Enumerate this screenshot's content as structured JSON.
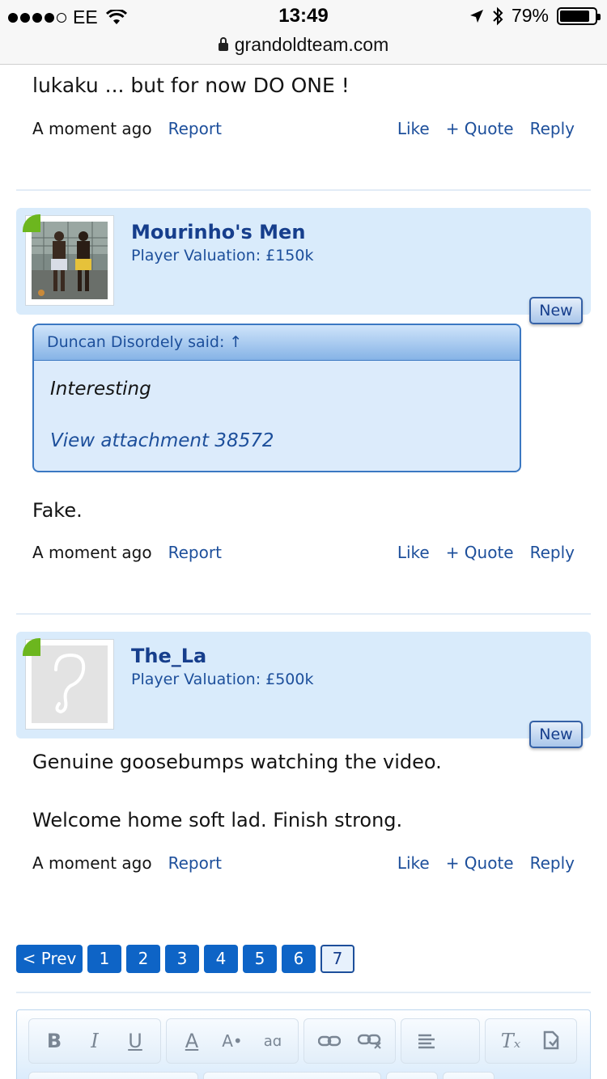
{
  "status_bar": {
    "carrier": "EE",
    "time": "13:49",
    "battery": "79%"
  },
  "browser": {
    "url": "grandoldteam.com"
  },
  "top_post": {
    "text_fragment": "lukaku ... but for now DO ONE !",
    "time": "A moment ago",
    "report": "Report",
    "like": "Like",
    "quote": "+ Quote",
    "reply": "Reply"
  },
  "posts": [
    {
      "username": "Mourinho's Men",
      "valuation": "Player Valuation: £150k",
      "badge": "New",
      "quote": {
        "header": "Duncan Disordely said: ↑",
        "text": "Interesting",
        "link": "View attachment 38572"
      },
      "body": "Fake.",
      "time": "A moment ago",
      "report": "Report",
      "like": "Like",
      "quote_btn": "+ Quote",
      "reply": "Reply"
    },
    {
      "username": "The_La",
      "valuation": "Player Valuation: £500k",
      "badge": "New",
      "body_lines": [
        "Genuine goosebumps watching the video.",
        "Welcome home soft lad. Finish strong."
      ],
      "time": "A moment ago",
      "report": "Report",
      "like": "Like",
      "quote_btn": "+ Quote",
      "reply": "Reply"
    }
  ],
  "pagination": {
    "prev": "< Prev",
    "pages": [
      "1",
      "2",
      "3",
      "4",
      "5",
      "6",
      "7"
    ],
    "current": "7"
  },
  "editor": {
    "toolbar_icons": [
      "bold-icon",
      "italic-icon",
      "underline-icon",
      "font-color-icon",
      "font-size-icon",
      "font-family-icon",
      "link-icon",
      "unlink-icon",
      "align-icon",
      "remove-format-icon",
      "undo-icon"
    ],
    "bold_glyph": "B",
    "italic_glyph": "I",
    "underline_glyph": "U",
    "font_color_glyph": "A",
    "font_size_glyph": "A•",
    "font_family_glyph": "aɑ",
    "clear_format_glyph": "Tₓ"
  },
  "colors": {
    "link": "#1d4f9b",
    "header_bg": "#d9ebfb",
    "pager_bg": "#0e64c6",
    "online_corner": "#6cb61e"
  }
}
